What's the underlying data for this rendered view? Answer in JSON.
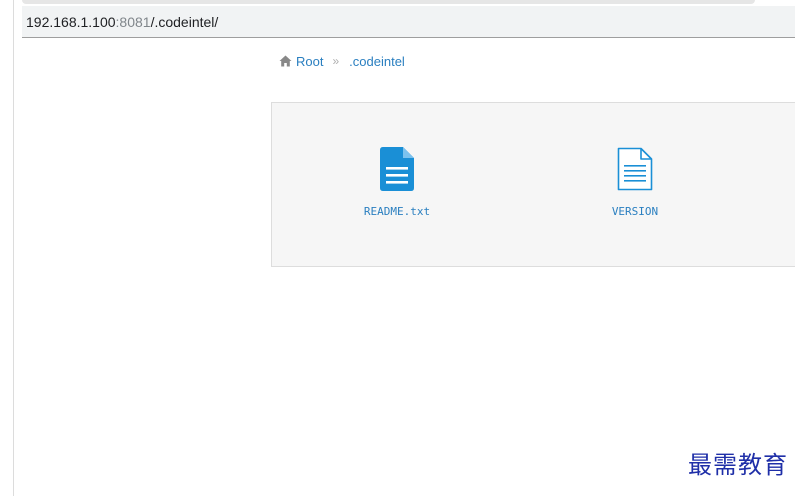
{
  "browser": {
    "address": {
      "host": "192.168.1.100",
      "port": ":8081",
      "path": "/.codeintel/"
    }
  },
  "breadcrumb": {
    "home_icon": "home-icon",
    "root_label": "Root",
    "separator": "»",
    "current_label": ".codeintel"
  },
  "files": [
    {
      "name": "README.txt",
      "icon": "text-file-filled-icon",
      "color": "#1a8fd6"
    },
    {
      "name": "VERSION",
      "icon": "text-file-outline-icon",
      "color": "#1a8fd6"
    }
  ],
  "watermark": "最需教育",
  "colors": {
    "link": "#2a7fc0",
    "panel_bg": "#f6f6f6",
    "watermark": "#1f2fa8"
  }
}
